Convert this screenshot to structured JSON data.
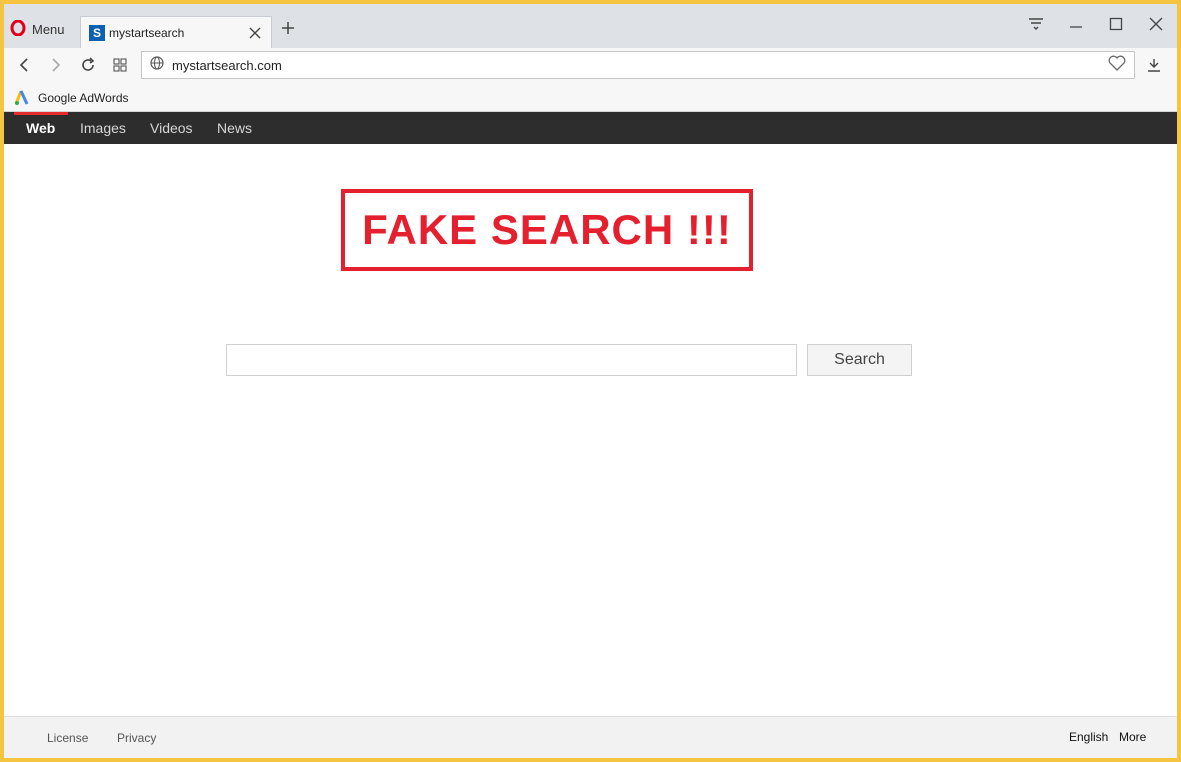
{
  "browser": {
    "menu_label": "Menu",
    "tab": {
      "title": "mystartsearch",
      "favicon_letter": "S"
    },
    "address": {
      "url": "mystartsearch.com"
    },
    "bookmarks": [
      {
        "label": "Google AdWords"
      }
    ]
  },
  "icons": {
    "opera": "opera-logo-icon",
    "close_tab": "close-icon",
    "new_tab": "plus-icon",
    "back": "chevron-left-icon",
    "forward": "chevron-right-icon",
    "reload": "reload-icon",
    "speed_dial": "grid-icon",
    "site": "globe-icon",
    "bookmark": "heart-icon",
    "download": "download-icon"
  },
  "page": {
    "nav": {
      "tabs": [
        "Web",
        "Images",
        "Videos",
        "News"
      ],
      "active": "Web"
    },
    "banner": {
      "text": "FAKE SEARCH !!!"
    },
    "search": {
      "button_label": "Search",
      "value": ""
    },
    "footer": {
      "left_links": [
        "License",
        "Privacy"
      ],
      "right_links": [
        "English",
        "More"
      ]
    }
  },
  "colors": {
    "window_border": "#f5c542",
    "nav_bg": "#2d2d2d",
    "accent_red": "#e5202e",
    "opera_red": "#e0001b",
    "favicon_blue": "#0d5fb1"
  }
}
